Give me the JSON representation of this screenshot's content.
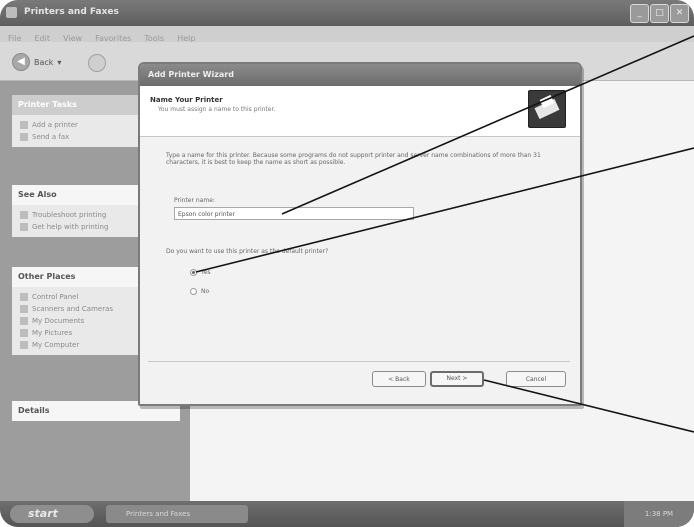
{
  "explorer": {
    "title": "Printers and Faxes",
    "menu": [
      "File",
      "Edit",
      "View",
      "Favorites",
      "Tools",
      "Help"
    ],
    "back_label": "Back"
  },
  "taskpane": {
    "printer_tasks": {
      "header": "Printer Tasks",
      "items": [
        "Add a printer",
        "Send a fax"
      ]
    },
    "see_also": {
      "header": "See Also",
      "items": [
        "Troubleshoot printing",
        "Get help with printing"
      ]
    },
    "other_places": {
      "header": "Other Places",
      "items": [
        "Control Panel",
        "Scanners and Cameras",
        "My Documents",
        "My Pictures",
        "My Computer"
      ]
    },
    "details": {
      "header": "Details"
    }
  },
  "dialog": {
    "title": "Add Printer Wizard",
    "header_title": "Name Your Printer",
    "header_subtitle": "You must assign a name to this printer.",
    "description": "Type a name for this printer. Because some programs do not support printer and server name combinations of more than 31 characters, it is best to keep the name as short as possible.",
    "printer_name_label": "Printer name:",
    "printer_name_value": "Epson color printer",
    "default_question": "Do you want to use this printer as the default printer?",
    "yes_label": "Yes",
    "no_label": "No",
    "selected_option": "yes",
    "back_button": "< Back",
    "next_button": "Next >",
    "cancel_button": "Cancel"
  },
  "taskbar": {
    "start_label": "start",
    "task_label": "Printers and Faxes",
    "tray_label": "1:38 PM"
  }
}
